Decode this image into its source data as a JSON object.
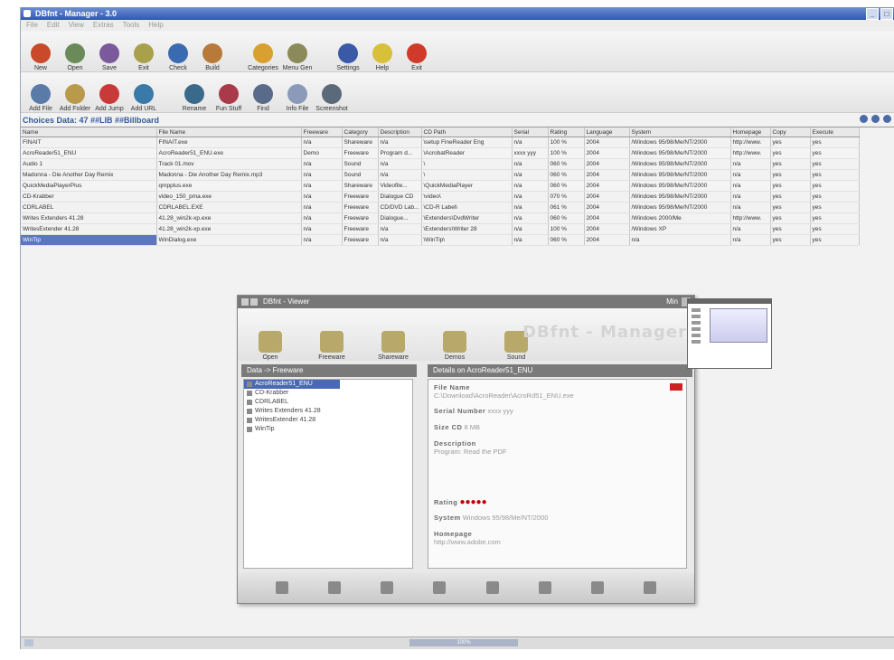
{
  "window": {
    "title": "DBfnt - Manager - 3.0"
  },
  "menu": [
    "File",
    "Edit",
    "View",
    "Extras",
    "Tools",
    "Help"
  ],
  "toolbar1": [
    {
      "label": "New",
      "icon": "new-icon",
      "color": "#c84a2a"
    },
    {
      "label": "Open",
      "icon": "open-icon",
      "color": "#6a8a5a"
    },
    {
      "label": "Save",
      "icon": "save-icon",
      "color": "#7a5a9a"
    },
    {
      "label": "Exit",
      "icon": "exit-icon",
      "color": "#a8a04a"
    },
    {
      "label": "Check",
      "icon": "check-icon",
      "color": "#3a6ab0"
    },
    {
      "label": "Build",
      "icon": "build-icon",
      "color": "#b87a3a"
    },
    {
      "label": "Categories",
      "icon": "categories-icon",
      "color": "#d8a030"
    },
    {
      "label": "Menu Gen",
      "icon": "menu-gen-icon",
      "color": "#8a8a5a"
    },
    {
      "label": "Settings",
      "icon": "settings-icon",
      "color": "#3a5aa8"
    },
    {
      "label": "Help",
      "icon": "help-icon",
      "color": "#d8c03a"
    },
    {
      "label": "Exit",
      "icon": "quit-icon",
      "color": "#d03a2a"
    }
  ],
  "toolbar2": [
    {
      "label": "Add File",
      "icon": "add-file-icon",
      "color": "#5a7aa8"
    },
    {
      "label": "Add Folder",
      "icon": "add-folder-icon",
      "color": "#b89a4a"
    },
    {
      "label": "Add Jump",
      "icon": "add-jump-icon",
      "color": "#c83a3a"
    },
    {
      "label": "Add URL",
      "icon": "add-url-icon",
      "color": "#3a7aa8"
    },
    {
      "label": "Rename",
      "icon": "rename-icon",
      "color": "#3a6a8a"
    },
    {
      "label": "Fun Stuff",
      "icon": "fun-stuff-icon",
      "color": "#a83a4a"
    },
    {
      "label": "Find",
      "icon": "find-icon",
      "color": "#5a6a8a"
    },
    {
      "label": "Info File",
      "icon": "info-file-icon",
      "color": "#8a9ab8"
    },
    {
      "label": "Screenshot",
      "icon": "screenshot-icon",
      "color": "#5a6a7a"
    }
  ],
  "status": {
    "text": "Choices Data: 47 ##LIB ##Billboard"
  },
  "grid": {
    "headers": [
      "Name",
      "File Name",
      "Freeware",
      "Category",
      "Description",
      "CD Path",
      "Serial",
      "Rating",
      "Language",
      "System",
      "Homepage",
      "Copy",
      "Execute"
    ],
    "rows": [
      [
        "FINAIT",
        "FINAIT.exe",
        "n/a",
        "Shareware",
        "n/a",
        "\\setup FineReader Eng",
        "n/a",
        "100 %",
        "2004",
        "/Windows 95/98/Me/NT/2000",
        "http://www.",
        "yes",
        "yes"
      ],
      [
        "AcroReader51_ENU",
        "AcroReader51_ENU.exe",
        "Demo",
        "Freeware",
        "Program d...",
        "\\AcrobatReader",
        "xxxx yyy",
        "100 %",
        "2004",
        "/Windows 95/98/Me/NT/2000",
        "http://www.",
        "yes",
        "yes"
      ],
      [
        "Audio 1",
        "Track 01.mov",
        "n/a",
        "Sound",
        "n/a",
        "\\",
        "n/a",
        "060 %",
        "2004",
        "/Windows 95/98/Me/NT/2000",
        "n/a",
        "yes",
        "yes"
      ],
      [
        "Madonna - Die Another Day Remix",
        "Madonna - Die Another Day Remix.mp3",
        "n/a",
        "Sound",
        "n/a",
        "\\",
        "n/a",
        "060 %",
        "2004",
        "/Windows 95/98/Me/NT/2000",
        "n/a",
        "yes",
        "yes"
      ],
      [
        "QuickMediaPlayerPlus",
        "qmpplus.exe",
        "n/a",
        "Shareware",
        "Videofile...",
        "\\QuickMediaPlayer",
        "n/a",
        "060 %",
        "2004",
        "/Windows 95/98/Me/NT/2000",
        "n/a",
        "yes",
        "yes"
      ],
      [
        "CD-Krabber",
        "video_150_pma.exe",
        "n/a",
        "Freeware",
        "Dialogue CD",
        "\\video\\",
        "n/a",
        "070 %",
        "2004",
        "/Windows 95/98/Me/NT/2000",
        "n/a",
        "yes",
        "yes"
      ],
      [
        "CDRLABEL",
        "CDRLABEL.EXE",
        "n/a",
        "Freeware",
        "CD/DVD Lab...",
        "\\CD-R Label\\",
        "n/a",
        "061 %",
        "2004",
        "/Windows 95/98/Me/NT/2000",
        "n/a",
        "yes",
        "yes"
      ],
      [
        "Writes Extenders 41.28",
        "41.28_win2k-xp.exe",
        "n/a",
        "Freeware",
        "Dialogue...",
        "\\Extenders\\DvdWriter",
        "n/a",
        "060 %",
        "2004",
        "/Windows 2000/Me",
        "http://www.",
        "yes",
        "yes"
      ],
      [
        "WritesExtender 41.28",
        "41.28_win2k-xp.exe",
        "n/a",
        "Freeware",
        "n/a",
        "\\Extenders\\Writer 28",
        "n/a",
        "100 %",
        "2004",
        "/Windows XP",
        "n/a",
        "yes",
        "yes"
      ],
      [
        "WinTip",
        "WinDialog.exe",
        "n/a",
        "Freeware",
        "n/a",
        "\\WinTip\\",
        "n/a",
        "060 %",
        "2004",
        "n/a",
        "n/a",
        "yes",
        "yes"
      ]
    ]
  },
  "inner": {
    "title": "DBfnt - Viewer",
    "mini": "Min",
    "watermark": "DBfnt - Manager",
    "tools": [
      {
        "label": "Open",
        "icon": "open-folder-icon"
      },
      {
        "label": "Freeware",
        "icon": "freeware-icon"
      },
      {
        "label": "Shareware",
        "icon": "shareware-icon"
      },
      {
        "label": "Demos",
        "icon": "demos-icon"
      },
      {
        "label": "Sound",
        "icon": "sound-icon"
      }
    ],
    "left_header": "Data -> Freeware",
    "right_header": "Details on AcroReader51_ENU",
    "tree": [
      "AcroReader51_ENU",
      "CD-Krabber",
      "CDRLABEL",
      "Writes Extenders 41.28",
      "WritesExtender 41.28",
      "WinTip"
    ],
    "details": {
      "file_name_label": "File Name",
      "file_name_value": "C:\\Download\\AcroReader\\AcroRd51_ENU.exe",
      "serial_label": "Serial Number",
      "serial_value": "xxxx yyy",
      "size_label": "Size CD",
      "size_value": "8 MB",
      "description_label": "Description",
      "description_value": "Program: Read the PDF",
      "rating_label": "Rating",
      "rating_value": "●●●●●",
      "system_label": "System",
      "system_value": "Windows 95/98/Me/NT/2000",
      "homepage_label": "Homepage",
      "homepage_value": "http://www.adobe.com"
    }
  },
  "scrollbar": {
    "label": "100%"
  }
}
